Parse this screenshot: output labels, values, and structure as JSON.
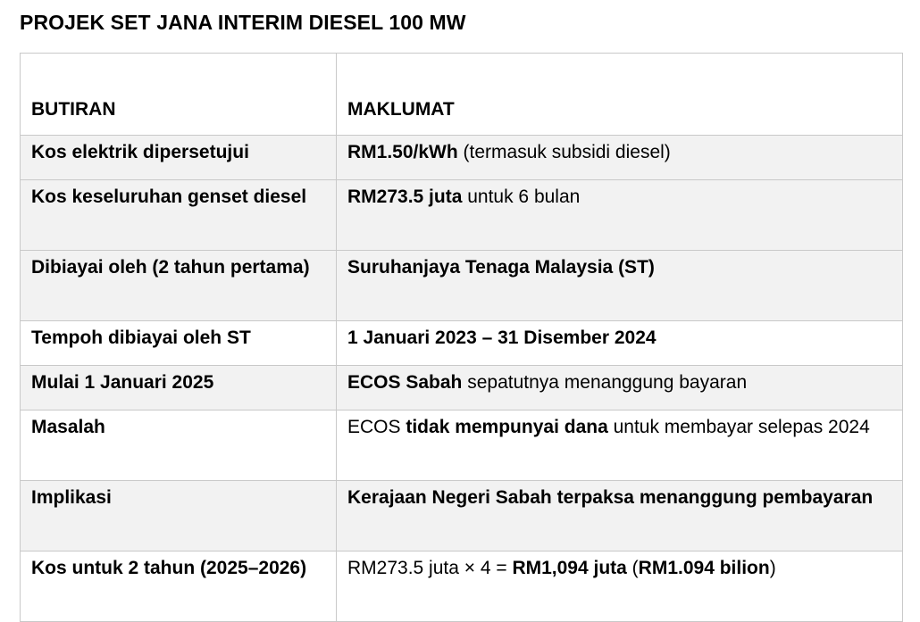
{
  "document": {
    "title": "PROJEK SET JANA INTERIM DIESEL 100 MW"
  },
  "table": {
    "headers": [
      "BUTIRAN",
      "MAKLUMAT"
    ],
    "rows": [
      {
        "label": "Kos elektrik dipersetujui",
        "value": [
          {
            "text": "RM1.50/kWh",
            "bold": true
          },
          {
            "text": " (termasuk subsidi diesel)",
            "bold": false
          }
        ]
      },
      {
        "label": "Kos keseluruhan genset diesel",
        "value": [
          {
            "text": "RM273.5 juta",
            "bold": true
          },
          {
            "text": " untuk 6 bulan",
            "bold": false
          }
        ]
      },
      {
        "label": "Dibiayai oleh (2 tahun pertama)",
        "value": [
          {
            "text": "Suruhanjaya Tenaga Malaysia (ST)",
            "bold": true
          }
        ]
      },
      {
        "label": "Tempoh dibiayai oleh ST",
        "value": [
          {
            "text": "1 Januari 2023 – 31 Disember 2024",
            "bold": true
          }
        ]
      },
      {
        "label": "Mulai 1 Januari 2025",
        "value": [
          {
            "text": "ECOS Sabah",
            "bold": true
          },
          {
            "text": " sepatutnya menanggung bayaran",
            "bold": false
          }
        ]
      },
      {
        "label": "Masalah",
        "value": [
          {
            "text": "ECOS ",
            "bold": false
          },
          {
            "text": "tidak mempunyai dana",
            "bold": true
          },
          {
            "text": " untuk membayar selepas 2024",
            "bold": false
          }
        ]
      },
      {
        "label": "Implikasi",
        "value": [
          {
            "text": "Kerajaan Negeri Sabah terpaksa menanggung pembayaran",
            "bold": true
          }
        ]
      },
      {
        "label": "Kos untuk 2 tahun (2025–2026)",
        "value": [
          {
            "text": "RM273.5 juta × 4 = ",
            "bold": false
          },
          {
            "text": "RM1,094 juta",
            "bold": true
          },
          {
            "text": " (",
            "bold": false
          },
          {
            "text": "RM1.094 bilion",
            "bold": true
          },
          {
            "text": ")",
            "bold": false
          }
        ]
      }
    ]
  },
  "colors": {
    "row_shade": "#f2f2f2",
    "border": "#c9c9c9",
    "text": "#000000"
  }
}
